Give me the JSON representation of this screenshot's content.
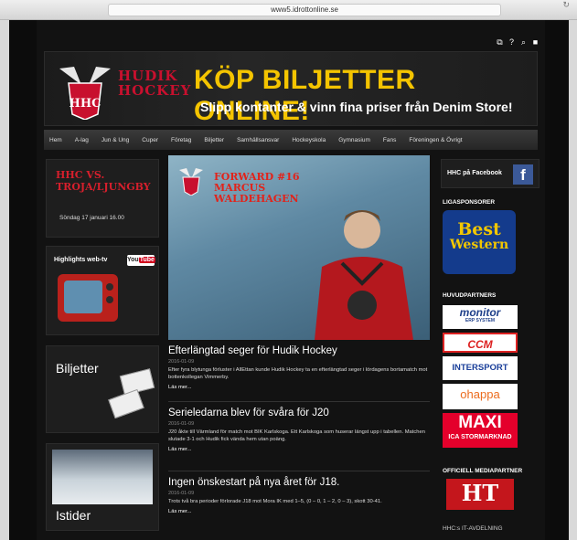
{
  "browser": {
    "url": "www5.idrottonline.se"
  },
  "header": {
    "logo_abbrev": "HHC",
    "logo_line1": "HUDIK",
    "logo_line2": "HOCKEY",
    "promo_title": "KÖP BILJETTER ONLINE!",
    "promo_subtitle": "Slipp kontanter & vinn fina priser från Denim Store!"
  },
  "nav": [
    "Hem",
    "A-lag",
    "Jun & Ung",
    "Cuper",
    "Företag",
    "Biljetter",
    "Samhällsansvar",
    "Hockeyskola",
    "Gymnasium",
    "Fans",
    "Föreningen & Övrigt"
  ],
  "left": {
    "match_line1": "HHC VS.",
    "match_line2": "TROJA/LJUNGBY",
    "match_date": "Söndag 17 januari 16.00",
    "highlights": "Highlights web-tv",
    "youtube_you": "You",
    "youtube_tube": "Tube",
    "biljetter": "Biljetter",
    "istider": "Istider"
  },
  "hero": {
    "line1": "FORWARD #16",
    "line2": "MARCUS",
    "line3": "WALDEHAGEN"
  },
  "articles": [
    {
      "title": "Efterlängtad seger för Hudik Hockey",
      "date": "2016-01-09",
      "body": "Efter fyra blytunga förluster i AllEttan kunde Hudik Hockey ta en efterlängtad seger i lördagens bortamatch mot bottenkollegan Vimmerby.",
      "more": "Läs mer..."
    },
    {
      "title": "Serieledarna blev för svåra för J20",
      "date": "2016-01-09",
      "body": "J20 åkte till Värmland för match mot BIK Karlskoga. Ett Karlskoga som huserar längst upp i tabellen. Matchen slutade 3-1 och Hudik fick vända hem utan poäng.",
      "more": "Läs mer..."
    },
    {
      "title": "Ingen önskestart på nya året för J18.",
      "date": "2016-01-09",
      "body": "Trots två bra perioder förlorade J18 mot Mora IK med 1–5, (0 – 0, 1 – 2, 0 – 3), skott 30-41.",
      "more": "Läs mer..."
    }
  ],
  "right": {
    "facebook": "HHC på Facebook",
    "liga_heading": "LIGASPONSORER",
    "bw_line1": "Best",
    "bw_line2": "Western",
    "huvud_heading": "HUVUDPARTNERS",
    "partners": [
      "monitor",
      "ERP SYSTEM",
      "CCM",
      "INTERSPORT",
      "ohappa",
      "MAXI",
      "ICA STORMARKNAD"
    ],
    "media_heading": "OFFICIELL MEDIAPARTNER",
    "ht": "HT",
    "it_heading": "HHC:s IT-AVDELNING"
  },
  "colors": {
    "accent_yellow": "#f4c400",
    "hhc_red": "#c8102e",
    "facebook": "#3b5998"
  }
}
